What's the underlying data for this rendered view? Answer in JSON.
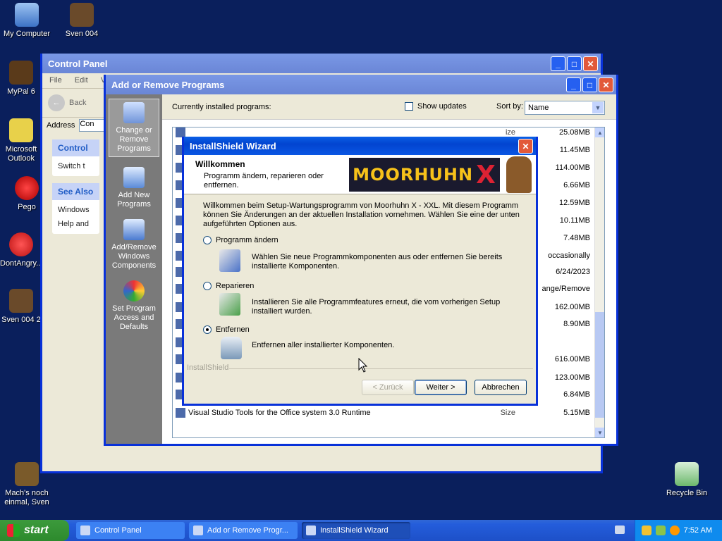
{
  "desktop": {
    "icons": [
      {
        "label": "My Computer"
      },
      {
        "label": "Sven 004"
      },
      {
        "label": "MyPal 6"
      },
      {
        "label": "Microsoft Outlook"
      },
      {
        "label": "Pego"
      },
      {
        "label": "DontAngry..."
      },
      {
        "label": "Sven 004 2"
      },
      {
        "label": "Mach's noch einmal, Sven"
      },
      {
        "label": "Recycle Bin"
      }
    ]
  },
  "control_panel": {
    "title": "Control Panel",
    "menu": [
      "File",
      "Edit",
      "Vie"
    ],
    "back_label": "Back",
    "address_label": "Address",
    "address_value": "Con",
    "panel_title": "Control",
    "switch_label": "Switch t",
    "see_also_title": "See Also",
    "see_also_items": [
      "Windows",
      "Help and"
    ]
  },
  "arp": {
    "title": "Add or Remove Programs",
    "sidebar": [
      {
        "label": "Change or Remove Programs"
      },
      {
        "label": "Add New Programs"
      },
      {
        "label": "Add/Remove Windows Components"
      },
      {
        "label": "Set Program Access and Defaults"
      }
    ],
    "installed_label": "Currently installed programs:",
    "show_updates": "Show updates",
    "sort_by_label": "Sort by:",
    "sort_value": "Name",
    "programs": [
      {
        "name": "",
        "size_label": "ize",
        "size": "25.08MB"
      },
      {
        "name": "",
        "size_label": "ize",
        "size": "11.45MB"
      },
      {
        "name": "",
        "size_label": "ize",
        "size": "114.00MB"
      },
      {
        "name": "",
        "size_label": "ize",
        "size": "6.66MB"
      },
      {
        "name": "",
        "size_label": "ize",
        "size": "12.59MB"
      },
      {
        "name": "",
        "size_label": "ize",
        "size": "10.11MB"
      },
      {
        "name": "",
        "size_label": "",
        "size": "7.48MB"
      },
      {
        "name": "",
        "size_label": "",
        "size": "occasionally"
      },
      {
        "name": "",
        "size_label": "",
        "size": "6/24/2023"
      },
      {
        "name": "",
        "size_label": "",
        "size": "ange/Remove"
      },
      {
        "name": "",
        "size_label": "",
        "size": "162.00MB"
      },
      {
        "name": "",
        "size_label": "",
        "size": "8.90MB"
      },
      {
        "name": "",
        "size_label": "",
        "size": ""
      },
      {
        "name": "",
        "size_label": "",
        "size": "616.00MB"
      },
      {
        "name": "",
        "size_label": "",
        "size": "123.00MB"
      },
      {
        "name": "",
        "size_label": "",
        "size": "6.84MB"
      },
      {
        "name": "Visual Studio Tools for the Office system 3.0 Runtime",
        "size_label": "Size",
        "size": "5.15MB"
      }
    ]
  },
  "wizard": {
    "title": "InstallShield Wizard",
    "header_title": "Willkommen",
    "header_sub": "Programm ändern, reparieren oder entfernen.",
    "logo_text": "MOORHUHN",
    "logo_x": "X",
    "intro": "Willkommen beim Setup-Wartungsprogramm von Moorhuhn X - XXL. Mit diesem Programm können Sie Änderungen an der aktuellen Installation vornehmen. Wählen Sie eine der unten aufgeführten Optionen aus.",
    "options": [
      {
        "label": "Programm ändern",
        "desc": "Wählen Sie neue Programmkomponenten aus oder entfernen Sie bereits installierte Komponenten.",
        "selected": false
      },
      {
        "label": "Reparieren",
        "desc": "Installieren Sie alle Programmfeatures erneut, die vom vorherigen Setup installiert wurden.",
        "selected": false
      },
      {
        "label": "Entfernen",
        "desc": "Entfernen aller installierter Komponenten.",
        "selected": true
      }
    ],
    "brand": "InstallShield",
    "back_button": "< Zurück",
    "next_button": "Weiter >",
    "cancel_button": "Abbrechen"
  },
  "taskbar": {
    "start_label": "start",
    "tasks": [
      {
        "label": "Control Panel"
      },
      {
        "label": "Add or Remove Progr..."
      },
      {
        "label": "InstallShield Wizard"
      }
    ],
    "clock": "7:52 AM"
  }
}
